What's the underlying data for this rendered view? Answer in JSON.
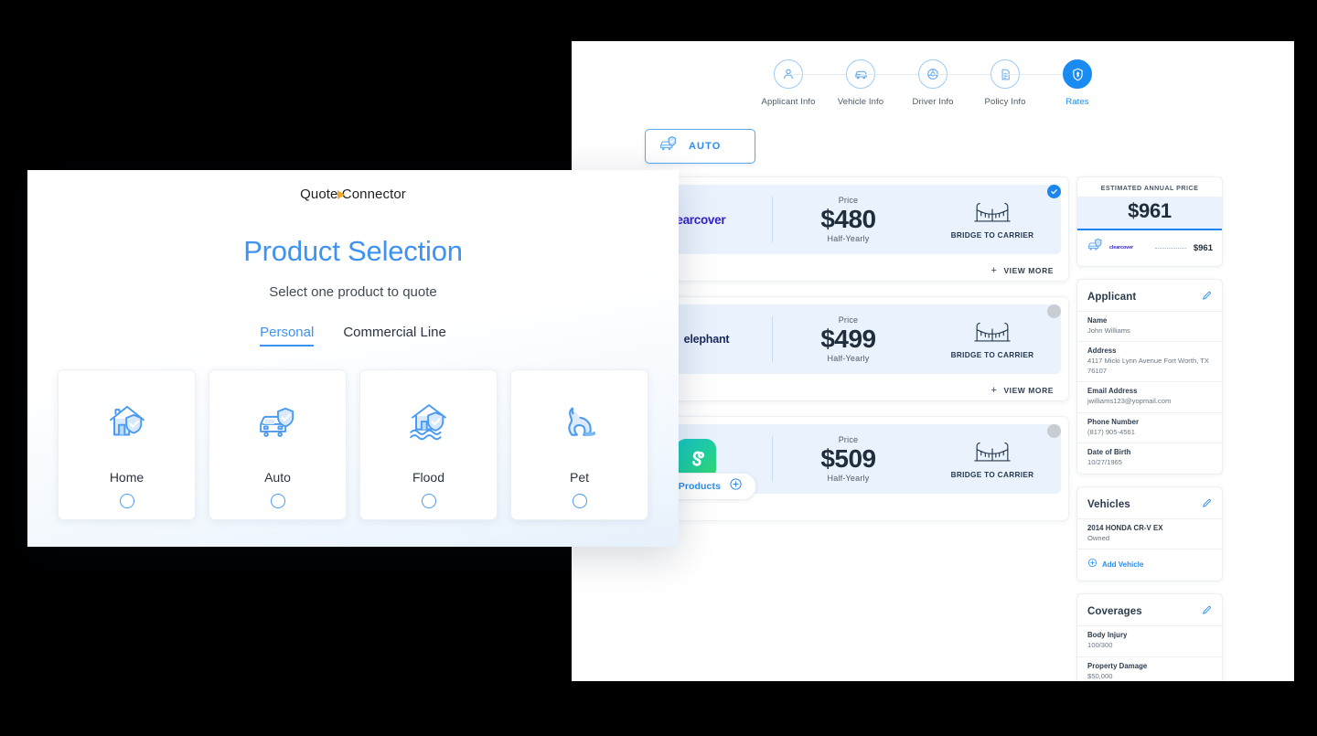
{
  "rates_screen": {
    "stepper": {
      "steps": [
        {
          "label": "Applicant Info",
          "icon": "person-icon",
          "active": false
        },
        {
          "label": "Vehicle Info",
          "icon": "car-icon",
          "active": false
        },
        {
          "label": "Driver Info",
          "icon": "steering-wheel-icon",
          "active": false
        },
        {
          "label": "Policy Info",
          "icon": "document-icon",
          "active": false
        },
        {
          "label": "Rates",
          "icon": "shield-dollar-icon",
          "active": true
        }
      ]
    },
    "product_tab": {
      "label": "AUTO",
      "icon": "car-shield-icon"
    },
    "rate_cards": [
      {
        "carrier": "clearcover",
        "logo_type": "wordmark",
        "price_caption": "Price",
        "price": "$480",
        "term": "Half-Yearly",
        "bridge_label": "BRIDGE TO CARRIER",
        "view_more": "VIEW MORE",
        "selected": true
      },
      {
        "carrier": "elephant",
        "logo_type": "wordmark",
        "price_caption": "Price",
        "price": "$499",
        "term": "Half-Yearly",
        "bridge_label": "BRIDGE TO CARRIER",
        "view_more": "VIEW MORE",
        "selected": false
      },
      {
        "carrier": "",
        "logo_type": "gradient-tile",
        "price_caption": "Price",
        "price": "$509",
        "term": "Half-Yearly",
        "bridge_label": "BRIDGE TO CARRIER",
        "view_more": "",
        "selected": false
      }
    ],
    "add_products": {
      "label": "Add Products",
      "icon": "plus-circle-icon"
    },
    "summary": {
      "estimated": {
        "title": "ESTIMATED ANNUAL PRICE",
        "amount": "$961",
        "row": {
          "carrier": "clearcover",
          "value": "$961",
          "icon": "car-shield-icon"
        }
      },
      "applicant": {
        "title": "Applicant",
        "edit_icon": "pencil-icon",
        "fields": [
          {
            "key": "Name",
            "value": "John Williams"
          },
          {
            "key": "Address",
            "value": "4117 Micki Lynn Avenue Fort Worth, TX 76107"
          },
          {
            "key": "Email Address",
            "value": "jwilliams123@yopmail.com"
          },
          {
            "key": "Phone Number",
            "value": "(817) 905-4561"
          },
          {
            "key": "Date of Birth",
            "value": "10/27/1965"
          }
        ]
      },
      "vehicles": {
        "title": "Vehicles",
        "edit_icon": "pencil-icon",
        "fields": [
          {
            "key": "2014 HONDA CR-V EX",
            "value": "Owned"
          }
        ],
        "add_label": "Add Vehicle"
      },
      "coverages": {
        "title": "Coverages",
        "edit_icon": "pencil-icon",
        "fields": [
          {
            "key": "Body Injury",
            "value": "100/300"
          },
          {
            "key": "Property Damage",
            "value": "$50,000"
          }
        ]
      }
    }
  },
  "product_selection": {
    "brand": {
      "first": "Quote",
      "second": "Connector"
    },
    "title": "Product Selection",
    "subtitle": "Select one product to quote",
    "tabs": [
      {
        "label": "Personal",
        "active": true
      },
      {
        "label": "Commercial Line",
        "active": false
      }
    ],
    "products": [
      {
        "label": "Home",
        "icon": "house-shield-icon"
      },
      {
        "label": "Auto",
        "icon": "car-shield-icon"
      },
      {
        "label": "Flood",
        "icon": "house-flood-icon"
      },
      {
        "label": "Pet",
        "icon": "dog-icon"
      }
    ]
  },
  "colors": {
    "accent_blue": "#1a86ee",
    "title_blue": "#3e93f0",
    "brand_orange": "#f5a623",
    "card_blue_bg": "#e9f2fd",
    "clearcover_purple": "#3323c7",
    "elephant_navy": "#1b2a5e"
  }
}
